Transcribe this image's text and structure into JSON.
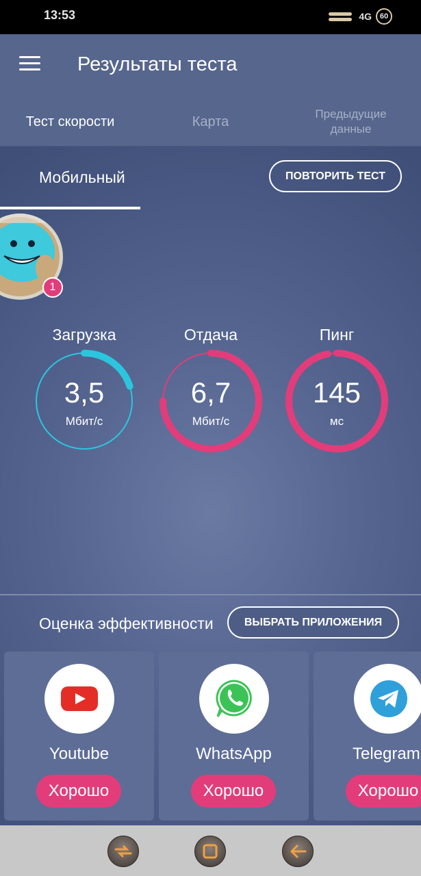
{
  "status_bar": {
    "time": "13:53",
    "network": "4G",
    "battery": "60"
  },
  "toolbar": {
    "title": "Результаты теста"
  },
  "tabs": [
    {
      "label": "Тест скорости",
      "active": true
    },
    {
      "label": "Карта",
      "active": false
    },
    {
      "label": "Предыдущие данные",
      "active": false
    }
  ],
  "connection": {
    "type": "Мобильный",
    "retest_label": "ПОВТОРИТЬ ТЕСТ"
  },
  "avatar": {
    "badge": "1"
  },
  "metrics": {
    "download": {
      "label": "Загрузка",
      "value": "3,5",
      "unit": "Мбит/с",
      "color": "#2bc6de",
      "fill_fraction": 0.2
    },
    "upload": {
      "label": "Отдача",
      "value": "6,7",
      "unit": "Мбит/с",
      "color": "#e23d7a",
      "fill_fraction": 0.75
    },
    "ping": {
      "label": "Пинг",
      "value": "145",
      "unit": "мс",
      "color": "#e23d7a",
      "fill_fraction": 0.97
    }
  },
  "performance": {
    "title": "Оценка эффективности",
    "choose_label": "ВЫБРАТЬ ПРИЛОЖЕНИЯ"
  },
  "apps": [
    {
      "name": "Youtube",
      "rating": "Хорошо",
      "icon": "youtube-icon"
    },
    {
      "name": "WhatsApp",
      "rating": "Хорошо",
      "icon": "whatsapp-icon"
    },
    {
      "name": "Telegram",
      "rating": "Хорошо",
      "icon": "telegram-icon"
    }
  ],
  "colors": {
    "accent_pink": "#e23d7a",
    "accent_cyan": "#2bc6de",
    "header_bg": "#56668d"
  }
}
